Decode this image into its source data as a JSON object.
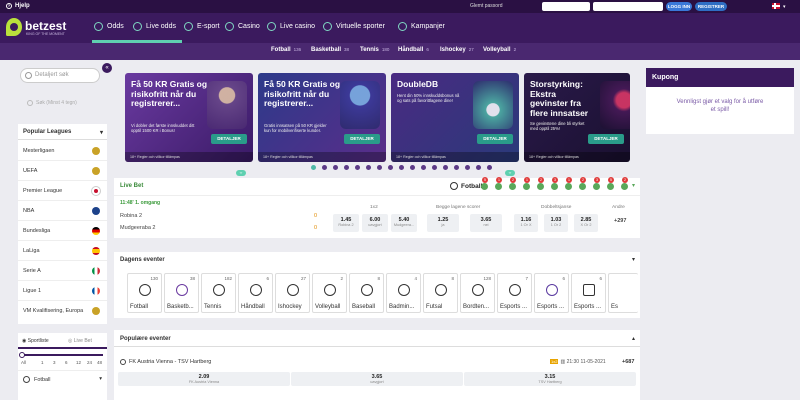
{
  "topbar": {
    "help": "Hjelp",
    "forgot": "Glemt passord",
    "login": "LOGG INN",
    "register": "REGISTRER",
    "colors": {
      "login": "#3a78d8",
      "register": "#2f6ec4"
    }
  },
  "logo": {
    "name": "betzest",
    "tagline": "KING OF THE MOMENT"
  },
  "nav": {
    "items": [
      {
        "label": "Odds",
        "icon": "odds-icon"
      },
      {
        "label": "Live odds",
        "icon": "clock-icon"
      },
      {
        "label": "E-sport",
        "icon": "esport-icon"
      },
      {
        "label": "Casino",
        "icon": "casino-icon"
      },
      {
        "label": "Live casino",
        "icon": "live-casino-icon"
      },
      {
        "label": "Virtuelle sporter",
        "icon": "virtual-sports-icon"
      },
      {
        "label": "Kampanjer",
        "icon": "campaign-icon"
      }
    ]
  },
  "sports_bar": [
    {
      "label": "Fotball",
      "count": "136"
    },
    {
      "label": "Basketball",
      "count": "38"
    },
    {
      "label": "Tennis",
      "count": "180"
    },
    {
      "label": "Håndball",
      "count": "6"
    },
    {
      "label": "Ishockey",
      "count": "27"
    },
    {
      "label": "Volleyball",
      "count": "2"
    }
  ],
  "sidebar": {
    "search_placeholder": "Detaljert søk",
    "search2_placeholder": "Søk (Minst 4 tegn)",
    "popular_title": "Popular Leagues",
    "leagues": [
      {
        "label": "Mesterligaen",
        "flag": "#c9a227"
      },
      {
        "label": "UEFA",
        "flag": "#c9a227"
      },
      {
        "label": "Premier League",
        "flag": "#c8102e"
      },
      {
        "label": "NBA",
        "flag": "#1d428a"
      },
      {
        "label": "Bundesliga",
        "flag": "#d00000"
      },
      {
        "label": "LaLiga",
        "flag": "#e8a400"
      },
      {
        "label": "Serie A",
        "flag": "#009246"
      },
      {
        "label": "Ligue 1",
        "flag": "#0055a4"
      },
      {
        "label": "VM Kvalifisering, Europa",
        "flag": "#c9a227"
      }
    ],
    "tab_sportlist": "Sportliste",
    "tab_livebet": "Live Bet",
    "slider_ticks": [
      "All",
      "1",
      "3",
      "6",
      "12",
      "24",
      "48"
    ],
    "sport_row": "Fotball"
  },
  "banners": [
    {
      "title": "Få 50 KR Gratis og risikofritt når du registrerer...",
      "desc": "Vi dobler det første innskuddet ditt opptil 1500 KR i Bonus!",
      "button": "DETALJER",
      "footer": "18+ Regler och villkor tillämpas",
      "bg": "#5a2d8a"
    },
    {
      "title": "Få 50 KR Gratis og risikofritt når du registrerer...",
      "desc": "Gratis innsatsen på 50 KR gjelder kun for mobilverifiserte kunder.",
      "button": "DETALJER",
      "footer": "18+ Regler och villkor tillämpas",
      "bg": "#3a2a7a"
    },
    {
      "title": "DoubleDB",
      "desc": "Hent din 50% innskuddsbonus nå og sats på favorittlagene dine!",
      "button": "DETALJER",
      "footer": "18+ Regler och villkor tillämpas",
      "bg": "#4a2a82"
    },
    {
      "title": "Storstyrking: Ekstra gevinster fra flere innsatser",
      "desc": "Se gevinstene dine bli styrket med opptil 25%!",
      "button": "DETALJER",
      "footer": "18+ Regler och villkor tillämpas",
      "bg": "#2a1a4a"
    }
  ],
  "kupong": {
    "title": "Kupong",
    "message": "Vennligst gjør et valg for å utføre et spill!"
  },
  "livebet": {
    "title": "Live Bet",
    "sport": "Fotball",
    "badges": [
      "5",
      "1",
      "2",
      "1",
      "2",
      "3",
      "1",
      "2",
      "3",
      "5",
      "2"
    ],
    "time": "11:48' 1. omgang",
    "home": "Robina 2",
    "away": "Mudgeeraba 2",
    "home_score": "0",
    "away_score": "0",
    "markets": [
      {
        "label": "1x2",
        "odds": [
          {
            "v": "1.45",
            "n": "Robina 2"
          },
          {
            "v": "6.00",
            "n": "uavgjort"
          },
          {
            "v": "5.40",
            "n": "Mudgeera..."
          }
        ]
      },
      {
        "label": "Begge lagene scorer",
        "odds": [
          {
            "v": "1.25",
            "n": "ja"
          },
          {
            "v": "3.65",
            "n": "nei"
          }
        ]
      },
      {
        "label": "Dobbeltsjanse",
        "odds": [
          {
            "v": "1.16",
            "n": "1 Or X"
          },
          {
            "v": "1.03",
            "n": "1 Or 2"
          },
          {
            "v": "2.85",
            "n": "X Or 2"
          }
        ]
      }
    ],
    "other_label": "Andre",
    "other_count": "+297"
  },
  "dagens": {
    "title": "Dagens eventer",
    "sports": [
      {
        "label": "Fotball",
        "count": "130"
      },
      {
        "label": "Basketb...",
        "count": "38"
      },
      {
        "label": "Tennis",
        "count": "182"
      },
      {
        "label": "Håndball",
        "count": "6"
      },
      {
        "label": "Ishockey",
        "count": "27"
      },
      {
        "label": "Volleyball",
        "count": "2"
      },
      {
        "label": "Baseball",
        "count": "8"
      },
      {
        "label": "Badmin...",
        "count": "4"
      },
      {
        "label": "Futsal",
        "count": "8"
      },
      {
        "label": "Bordten...",
        "count": "128"
      },
      {
        "label": "Esports ...",
        "count": "7"
      },
      {
        "label": "Esports ...",
        "count": "6"
      },
      {
        "label": "Esports ...",
        "count": "6"
      },
      {
        "label": "Es",
        "count": ""
      }
    ]
  },
  "popular": {
    "title": "Populære eventer",
    "match": "FK Austria Vienna - TSV Hartberg",
    "market_tag": "1x2",
    "time": "21:30 11-05-2021",
    "count": "+687",
    "odds": [
      {
        "v": "2.09",
        "n": "FK Austria Vienna"
      },
      {
        "v": "3.65",
        "n": "uavgjort"
      },
      {
        "v": "3.15",
        "n": "TSV Hartberg"
      }
    ]
  }
}
